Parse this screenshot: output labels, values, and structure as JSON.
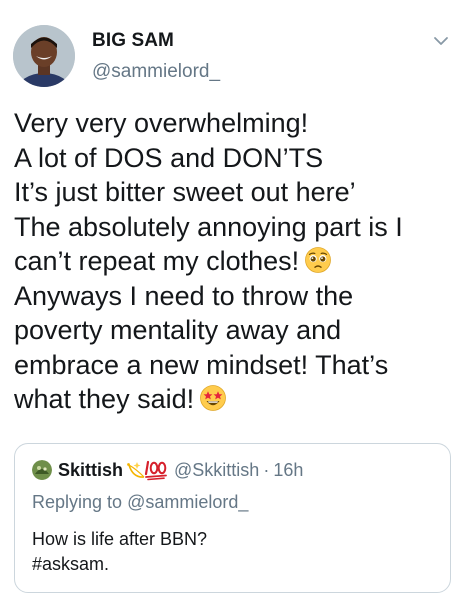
{
  "author": {
    "name": "BIG SAM",
    "handle": "@sammielord_",
    "avatar_icon": "profile-photo"
  },
  "menu_icon": "chevron-down-icon",
  "tweet": {
    "lines": [
      "Very very overwhelming!",
      "A lot of DOS and DON’TS",
      "It’s just bitter sweet out here’",
      "The absolutely annoying part is I",
      "can’t repeat my clothes!",
      "Anyways I need to throw the",
      "poverty mentality away and",
      "embrace a new mindset! That’s",
      "what they said!"
    ],
    "emoji_1": "pleading-face-emoji",
    "emoji_2": "star-struck-emoji"
  },
  "quoted_tweet": {
    "name": "Skittish",
    "decoration_icons": [
      "sparkle-emoji",
      "hundred-points-emoji"
    ],
    "handle": "@Skkittish",
    "separator": "·",
    "time": "16h",
    "replying_to_prefix": "Replying to",
    "replying_to_handle": "@sammielord_",
    "lines": [
      "How is life after BBN?",
      "#asksam."
    ]
  },
  "colors": {
    "text": "#14171a",
    "secondary": "#657786",
    "border": "#ccd6dd",
    "background": "#ffffff"
  }
}
